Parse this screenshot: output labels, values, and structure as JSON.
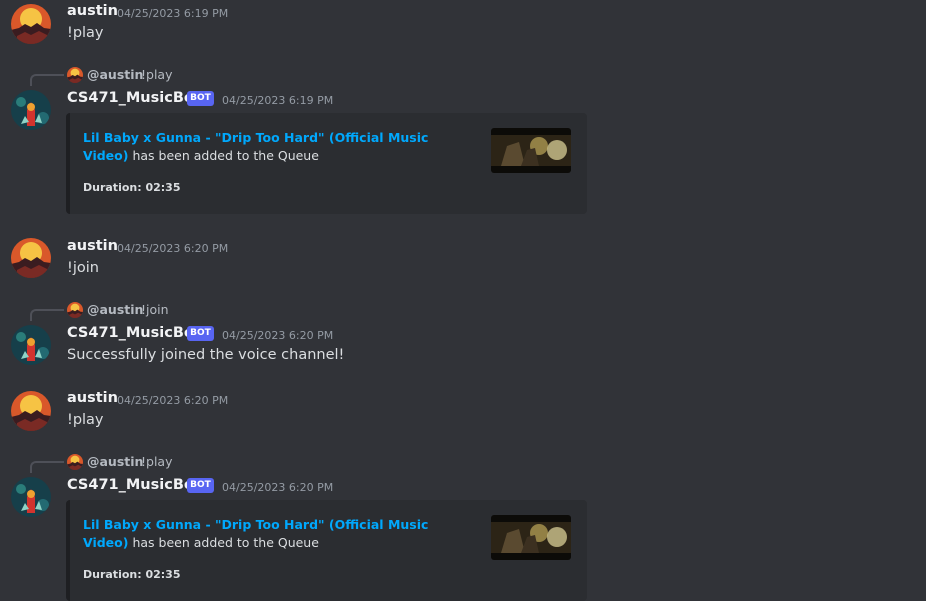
{
  "users": {
    "austin": "austin",
    "bot": "CS471_MusicBot",
    "bot_badge": "BOT"
  },
  "messages": [
    {
      "author": "austin",
      "timestamp": "04/25/2023 6:19 PM",
      "content": "!play"
    },
    {
      "author": "CS471_MusicBot",
      "timestamp": "04/25/2023 6:19 PM",
      "reply": {
        "mention": "@austin",
        "text": "!play"
      },
      "embed": {
        "link": "Lil Baby x Gunna - \"Drip Too Hard\" (Official Music Video)",
        "suffix": " has been added to the Queue",
        "duration": "Duration: 02:35"
      }
    },
    {
      "author": "austin",
      "timestamp": "04/25/2023 6:20 PM",
      "content": "!join"
    },
    {
      "author": "CS471_MusicBot",
      "timestamp": "04/25/2023 6:20 PM",
      "reply": {
        "mention": "@austin",
        "text": "!join"
      },
      "content": "Successfully joined the voice channel!"
    },
    {
      "author": "austin",
      "timestamp": "04/25/2023 6:20 PM",
      "content": "!play"
    },
    {
      "author": "CS471_MusicBot",
      "timestamp": "04/25/2023 6:20 PM",
      "reply": {
        "mention": "@austin",
        "text": "!play"
      },
      "embed": {
        "link": "Lil Baby x Gunna - \"Drip Too Hard\" (Official Music Video)",
        "suffix": " has been added to the Queue",
        "duration": "Duration: 02:35"
      }
    }
  ],
  "colors": {
    "background": "#313338",
    "embed_bg": "#2b2d31",
    "link": "#00a8fc",
    "bot_badge": "#5865f2",
    "timestamp": "#949ba4"
  }
}
